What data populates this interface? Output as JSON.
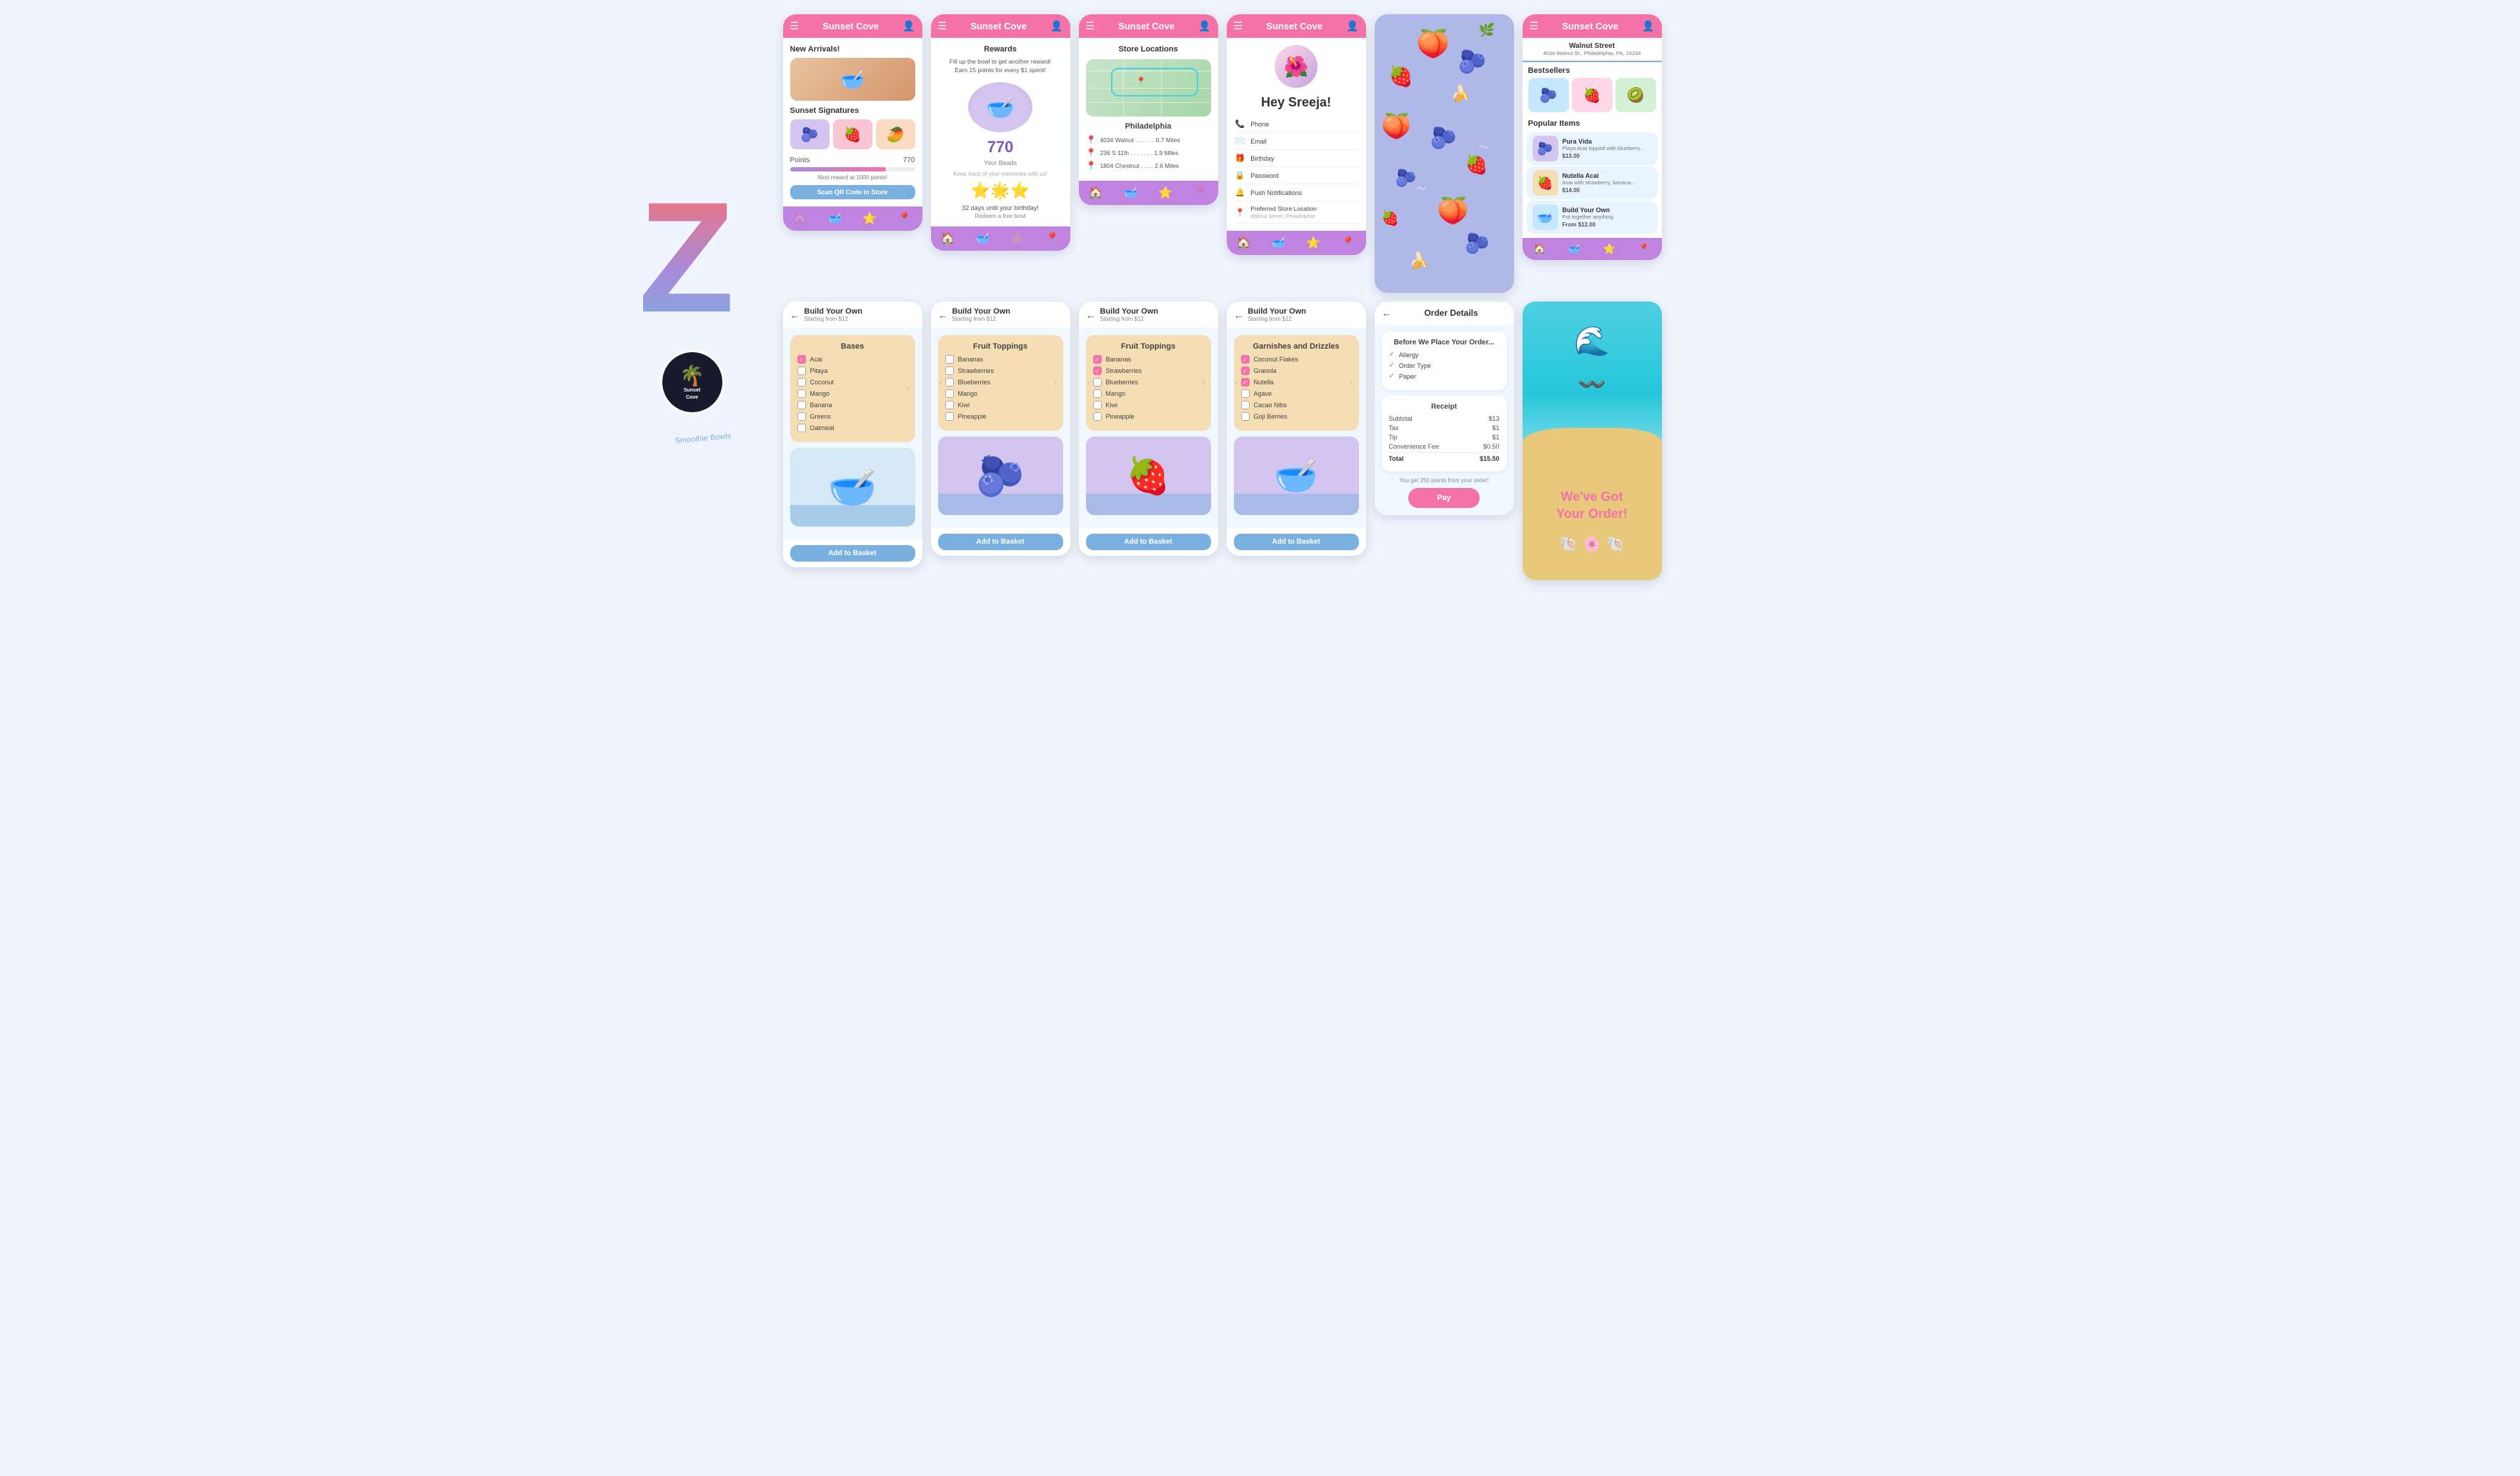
{
  "app": {
    "name": "Sunset Cove",
    "tagline": "Smoothie Bowls"
  },
  "header": {
    "title": "Sunset Cove"
  },
  "home": {
    "new_arrivals": "New Arrivals!",
    "sunset_signatures": "Sunset Signatures",
    "points_label": "Points",
    "points_value": "770",
    "next_reward": "Next reward at 1000 points!",
    "scan_btn": "Scan QR Code in Store"
  },
  "rewards": {
    "title": "Rewards",
    "subtitle": "Fill up the bowl to get another reward!\nEarn 15 points for every $1 spent!",
    "points": "770",
    "your_beads": "Your Beads",
    "beads_subtitle": "Keep track of your memories with us!",
    "bday_note": "32 days until your birthday!",
    "bday_redeem": "Redeem a free bowl"
  },
  "locations": {
    "title": "Store Locations",
    "city": "Philadelphia",
    "stores": [
      {
        "address": "4034 Walnut",
        "distance": "0.7 Miles"
      },
      {
        "address": "236 S 11th",
        "distance": "1.9 Miles"
      },
      {
        "address": "1804 Chestnut",
        "distance": "2.6 Miles"
      }
    ]
  },
  "profile": {
    "greeting": "Hey Sreeja!",
    "fields": [
      "Phone",
      "Email",
      "Birthday",
      "Password",
      "Push Notifications",
      "Preferred Store Location"
    ],
    "preferred_store": "Walnut Street, Philadelphia"
  },
  "build_your_own": {
    "title": "Build Your Own",
    "subtitle": "Starting from $12",
    "back": "←",
    "bases_title": "Bases",
    "bases": [
      "Acai",
      "Pitaya",
      "Coconut",
      "Mango",
      "Banana",
      "Greens",
      "Oatmeal"
    ],
    "fruit_title": "Fruit Toppings",
    "fruits": [
      "Bananas",
      "Strawberries",
      "Blueberries",
      "Mango",
      "Kiwi",
      "Pineapple"
    ],
    "fruits_checked": [
      "Bananas",
      "Strawberries"
    ],
    "garnishes_title": "Garnishes and Drizzles",
    "garnishes": [
      "Coconut Flakes",
      "Granola",
      "Nutella",
      "Agave",
      "Cacao Nibs",
      "Goji Berries"
    ],
    "garnishes_checked": [
      "Coconut Flakes",
      "Granola",
      "Nutella"
    ],
    "add_basket": "Add to Basket"
  },
  "order_details": {
    "title": "Order Details",
    "before_order": "Before We Place Your Order...",
    "checks": [
      "Allergy",
      "Order Type",
      "Paper"
    ],
    "receipt_title": "Receipt",
    "subtotal_label": "Subtotal",
    "subtotal": "$13",
    "tax_label": "Tax",
    "tax": "$1",
    "tip_label": "Tip",
    "tip": "$1",
    "convenience_label": "Convenience Fee",
    "convenience": "$0.50",
    "total_label": "Total",
    "total": "$15.50",
    "points_note": "You get 250 points from your order!",
    "pay_btn": "Pay"
  },
  "confirmation": {
    "message": "We've Got\nYour Order!"
  },
  "bestsellers": {
    "address_main": "Walnut Street",
    "address_sub": "4034 Walnut St., Philadelphia, PA, 19104",
    "section_title": "Bestsellers",
    "popular_title": "Popular Items",
    "items": [
      {
        "name": "Pura Vida",
        "desc": "Playa Acai topped with blueberry...",
        "price": "$13.00",
        "emoji": "🍓"
      },
      {
        "name": "Nutella Acai",
        "desc": "Acai with strawberry, banana...",
        "price": "$14.00",
        "emoji": "🍌"
      },
      {
        "name": "Build Your Own",
        "desc": "Put together anything",
        "price": "From $12.00",
        "emoji": "🥣"
      }
    ]
  },
  "nav": {
    "home_icon": "🏠",
    "bowl_icon": "🥣",
    "star_icon": "⭐",
    "pin_icon": "📍"
  },
  "colors": {
    "pink": "#f472a8",
    "purple": "#c084e0",
    "blue": "#7ab0e0",
    "tan": "#f5deb3",
    "fruit_bg": "#b0b8e8"
  }
}
